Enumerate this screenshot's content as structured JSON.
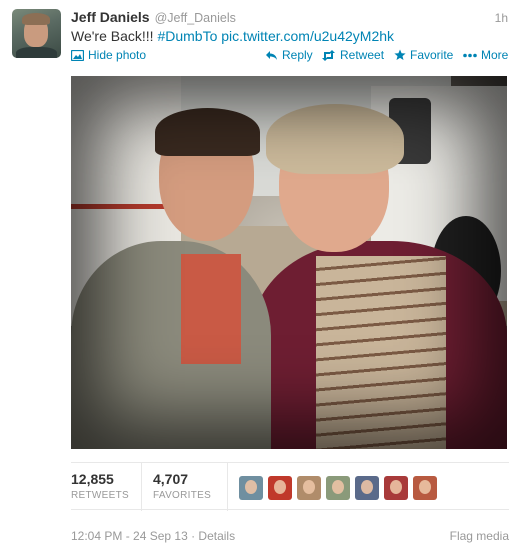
{
  "tweet": {
    "fullname": "Jeff Daniels",
    "username": "@Jeff_Daniels",
    "timestamp": "1h",
    "text_plain": "We're Back!!!",
    "hashtag": "#DumbTo",
    "pic_link": "pic.twitter.com/u2u42yM2hk"
  },
  "actions": {
    "hide_photo": "Hide photo",
    "reply": "Reply",
    "retweet": "Retweet",
    "favorite": "Favorite",
    "more": "More"
  },
  "stats": {
    "retweets_count": "12,855",
    "retweets_label": "RETWEETS",
    "favorites_count": "4,707",
    "favorites_label": "FAVORITES"
  },
  "favoriters": [
    {
      "color": "#6f8fa0"
    },
    {
      "color": "#c0392b"
    },
    {
      "color": "#b08c6a"
    },
    {
      "color": "#8a9a7a"
    },
    {
      "color": "#5a6a8a"
    },
    {
      "color": "#a83a3a"
    },
    {
      "color": "#b85a40"
    }
  ],
  "footer": {
    "datetime": "12:04 PM - 24 Sep 13",
    "separator": " · ",
    "details": "Details",
    "flag_media": "Flag media"
  },
  "colors": {
    "link": "#0084b4",
    "muted": "#999999",
    "text": "#333333"
  },
  "icons": {
    "hide_photo": "image-icon",
    "reply": "reply-arrow-icon",
    "retweet": "retweet-icon",
    "favorite": "star-icon",
    "more": "ellipsis-icon"
  }
}
